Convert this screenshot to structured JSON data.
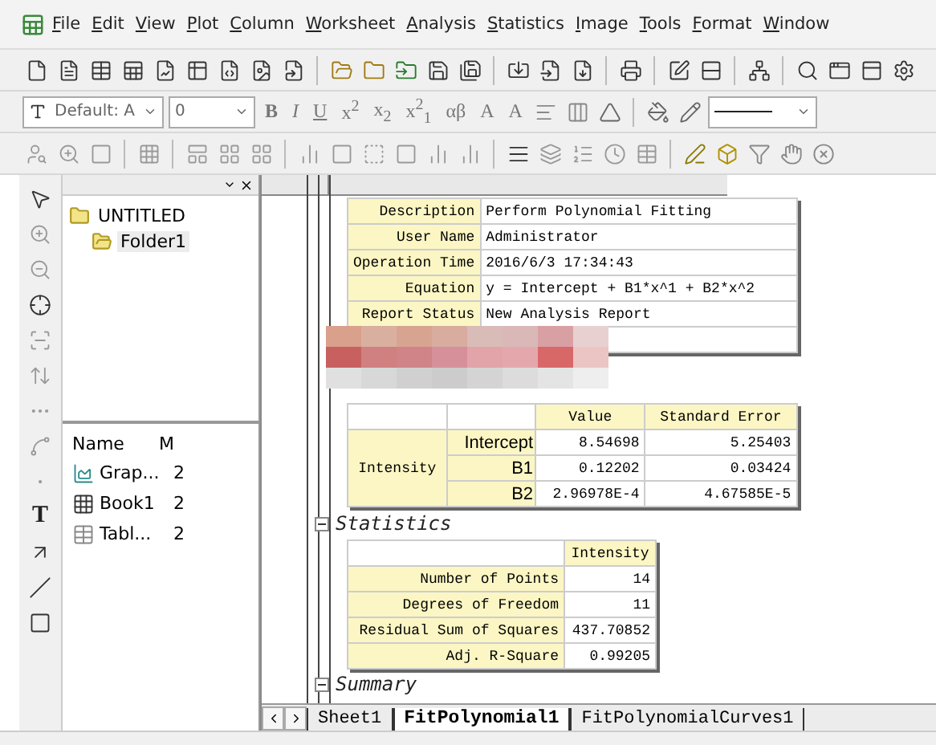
{
  "menu": [
    {
      "label": "File"
    },
    {
      "label": "Edit"
    },
    {
      "label": "View"
    },
    {
      "label": "Plot"
    },
    {
      "label": "Column"
    },
    {
      "label": "Worksheet"
    },
    {
      "label": "Analysis"
    },
    {
      "label": "Statistics"
    },
    {
      "label": "Image"
    },
    {
      "label": "Tools"
    },
    {
      "label": "Format"
    },
    {
      "label": "Window"
    }
  ],
  "format_toolbar": {
    "font": "Default: A",
    "size": "0",
    "buttons": [
      "B",
      "I",
      "U",
      "x$^{2}$",
      "x$_{2}$",
      "x$^{2}$$_{1}$",
      "αβ",
      "A",
      "A"
    ]
  },
  "tools_strip": {
    "text_tool": "T"
  },
  "project_explorer": {
    "tree": {
      "label": "UNTITLED",
      "children": [
        {
          "label": "Folder1",
          "selected": true
        }
      ]
    },
    "columns": [
      "Name",
      "M"
    ],
    "items": [
      {
        "kind": "graph",
        "name": "Grap...",
        "column_2": "2"
      },
      {
        "kind": "book",
        "name": "Book1",
        "column_2": "2"
      },
      {
        "kind": "table",
        "name": "Tabl...",
        "column_2": "2"
      }
    ]
  },
  "report": {
    "notes": [
      {
        "label": "Description",
        "value": "Perform Polynomial Fitting"
      },
      {
        "label": "User Name",
        "value": "Administrator"
      },
      {
        "label": "Operation Time",
        "value": "2016/6/3 17:34:43"
      },
      {
        "label": "Equation",
        "value": "y = Intercept + B1*x^1 + B2*x^2"
      },
      {
        "label": "Report Status",
        "value": "New Analysis Report"
      }
    ],
    "parameters": {
      "columns": [
        "Value",
        "Standard Error"
      ],
      "group": "Intensity",
      "rows": [
        {
          "name": "Intercept",
          "value": "8.54698",
          "error": "5.25403"
        },
        {
          "name": "B1",
          "value": "0.12202",
          "error": "0.03424"
        },
        {
          "name": "B2",
          "value": "2.96978E-4",
          "error": "4.67585E-5"
        }
      ]
    },
    "statistics": {
      "title": "Statistics",
      "column": "Intensity",
      "rows": [
        {
          "label": "Number of Points",
          "value": "14"
        },
        {
          "label": "Degrees of Freedom",
          "value": "11"
        },
        {
          "label": "Residual Sum of Squares",
          "value": "437.70852"
        },
        {
          "label": "Adj. R-Square",
          "value": "0.99205"
        }
      ]
    },
    "summary": {
      "title": "Summary"
    }
  },
  "sheet_tabs": [
    {
      "label": "Sheet1",
      "selected": false
    },
    {
      "label": "FitPolynomial1",
      "selected": true
    },
    {
      "label": "FitPolynomialCurves1",
      "selected": false
    }
  ]
}
